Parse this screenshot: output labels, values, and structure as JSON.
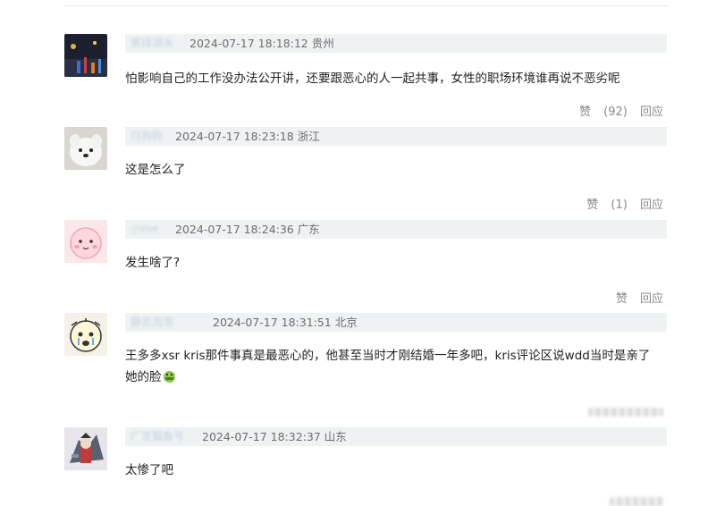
{
  "comments": [
    {
      "username": "黄绿湖水",
      "timestamp": "2024-07-17 18:18:12",
      "location": "贵州",
      "content": "怕影响自己的工作没办法公开讲，还要跟恶心的人一起共事，女性的职场环境谁再说不恶劣呢",
      "like_label": "赞",
      "like_count": "(92)",
      "reply_label": "回应",
      "avatar": "night-city-lights-avatar"
    },
    {
      "username": "白狗狗",
      "timestamp": "2024-07-17 18:23:18",
      "location": "浙江",
      "content": "这是怎么了",
      "like_label": "赞",
      "like_count": "(1)",
      "reply_label": "回应",
      "avatar": "white-dog-avatar"
    },
    {
      "username": "小me",
      "timestamp": "2024-07-17 18:24:36",
      "location": "广东",
      "content": "发生啥了?",
      "like_label": "赞",
      "like_count": "",
      "reply_label": "回应",
      "avatar": "pink-cartoon-avatar"
    },
    {
      "username": "静言泡泡",
      "timestamp": "2024-07-17 18:31:51",
      "location": "北京",
      "content": "王多多xsr kris那件事真是最恶心的，他甚至当时才刚结婚一年多吧，kris评论区说wdd当时是亲了",
      "content_line2": "她的脸",
      "avatar": "crying-cartoon-avatar"
    },
    {
      "username": "广发猫鱼号",
      "timestamp": "2024-07-17 18:32:37",
      "location": "山东",
      "content": "太惨了吧",
      "avatar": "anime-mech-avatar"
    }
  ],
  "colors": {
    "meta_bg": "#eef2f3",
    "meta_text": "#6d6d6d",
    "content_text": "#222222",
    "action_text": "#888888"
  }
}
